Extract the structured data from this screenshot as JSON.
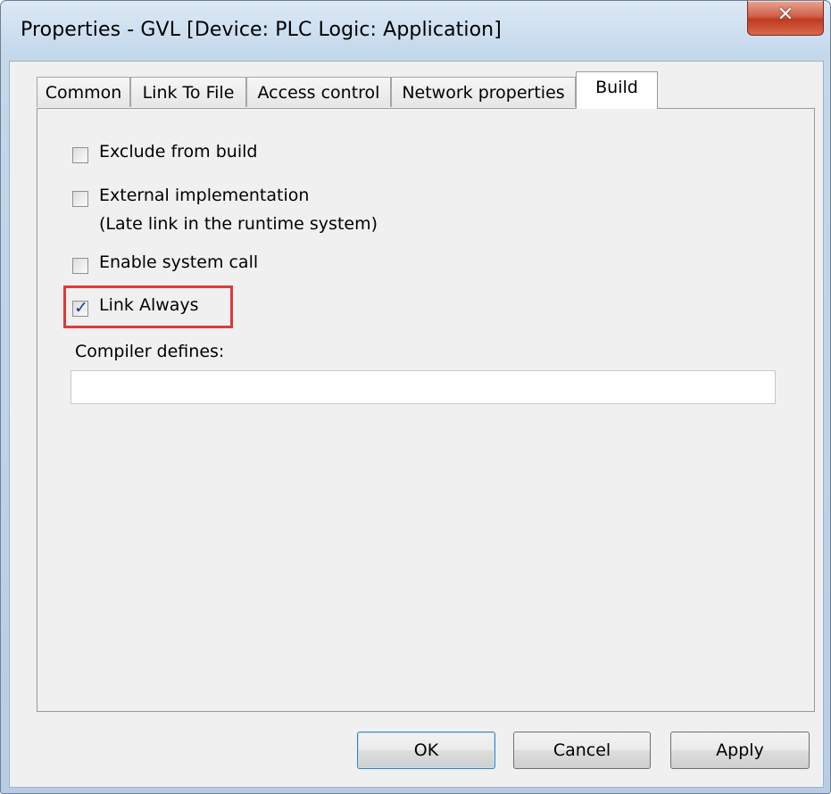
{
  "window": {
    "title": "Properties - GVL [Device: PLC Logic: Application]",
    "close_symbol": "✕",
    "close_icon": "close-icon"
  },
  "tabs": [
    {
      "label": "Common",
      "active": false
    },
    {
      "label": "Link To File",
      "active": false
    },
    {
      "label": "Access control",
      "active": false
    },
    {
      "label": "Network properties",
      "active": false
    },
    {
      "label": "Build",
      "active": true
    }
  ],
  "build": {
    "options": [
      {
        "label": "Exclude from build",
        "checked": false
      },
      {
        "label": "External implementation",
        "sublabel": "(Late link in the runtime system)",
        "checked": false
      },
      {
        "label": "Enable system call",
        "checked": false
      },
      {
        "label": "Link Always",
        "checked": true,
        "highlighted": true
      }
    ],
    "compiler_defines_label": "Compiler defines:",
    "compiler_defines_value": ""
  },
  "buttons": {
    "ok": "OK",
    "cancel": "Cancel",
    "apply": "Apply"
  },
  "colors": {
    "highlight": "#e03a36",
    "checkmark": "#1e3a8a",
    "close_button": "#c03a22"
  }
}
